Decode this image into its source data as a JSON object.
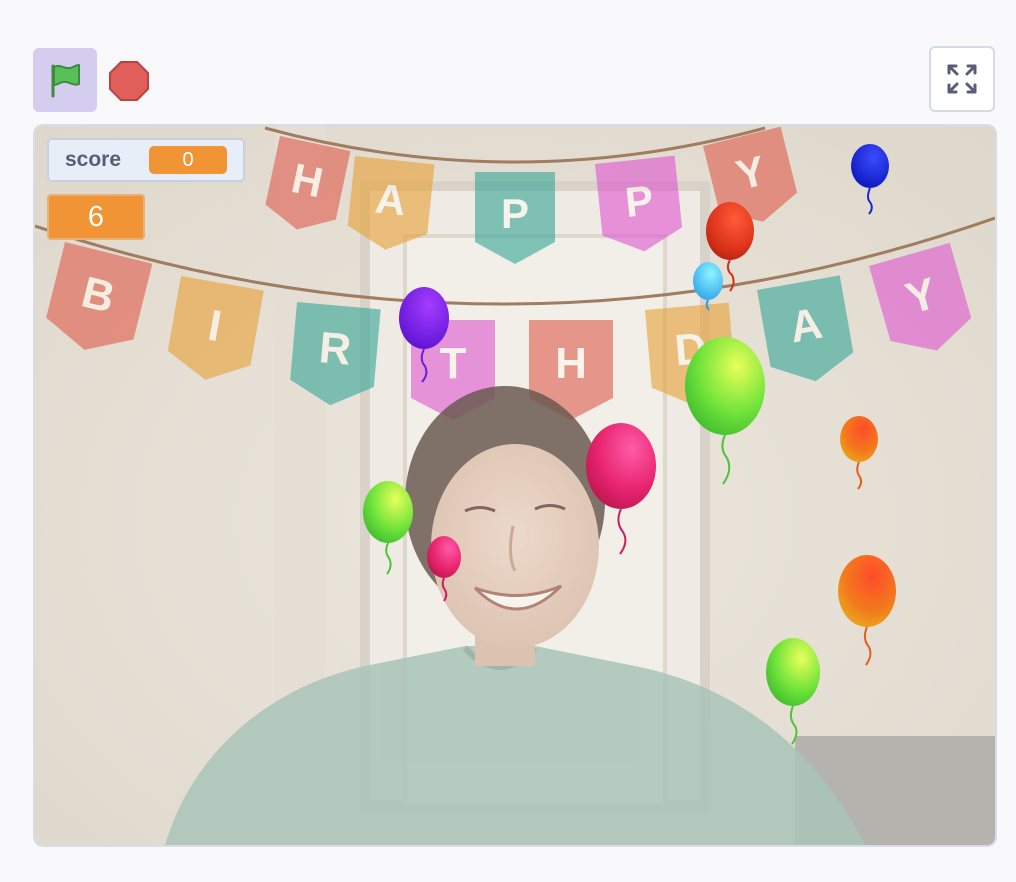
{
  "toolbar": {
    "green_flag_icon": "green-flag-icon",
    "stop_icon": "stop-sign-icon",
    "fullscreen_icon": "fullscreen-expand-icon"
  },
  "stage": {
    "banner_top_letters": [
      "H",
      "A",
      "P",
      "P",
      "Y"
    ],
    "banner_bottom_letters": [
      "B",
      "I",
      "R",
      "T",
      "H",
      "D",
      "A",
      "Y"
    ],
    "monitors": {
      "score_label": "score",
      "score_value": "0",
      "large_value": "6"
    }
  },
  "colors": {
    "flag_button_bg": "#d5cdf0",
    "monitor_orange": "#f09435",
    "monitor_label": "#575e75",
    "stop_red": "#e05f5a",
    "flag_green": "#59c059"
  }
}
